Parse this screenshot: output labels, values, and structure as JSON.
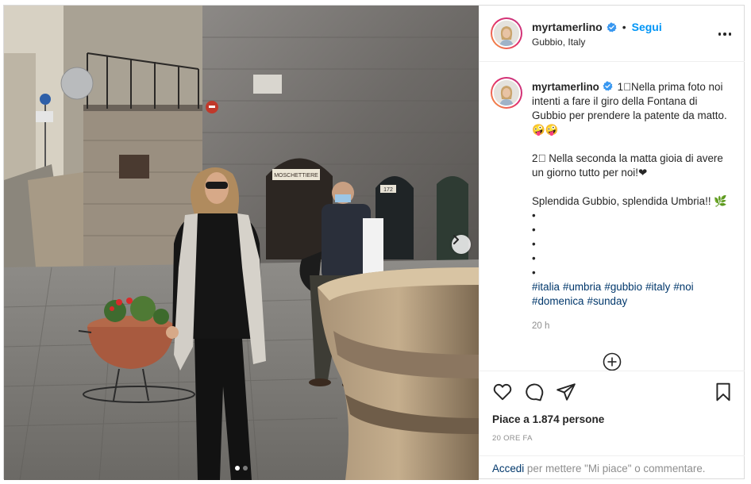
{
  "post": {
    "username": "myrtamerlino",
    "follow_label": "Segui",
    "separator": "•",
    "location": "Gubbio, Italy",
    "verified": true,
    "accent_color": "#0095f6",
    "caption_user": "myrtamerlino",
    "caption_text": " 1⃣Nella prima foto noi intenti a fare il giro della Fontana di Gubbio per prendere la patente da matto. 🤪🤪\n\n2⃣ Nella seconda la matta gioia di avere un giorno tutto per noi!❤\n\nSplendida Gubbio, splendida Umbria!! 🌿\n•\n•\n•\n•\n•",
    "hashtags": [
      "#italia",
      "#umbria",
      "#gubbio",
      "#italy",
      "#noi",
      "#domenica",
      "#sunday"
    ],
    "time_ago": "20 h",
    "likes_text": "Piace a 1.874 persone",
    "date_text": "20 ORE FA",
    "footer_login": "Accedi",
    "footer_rest": " per mettere \"Mi piace\" o commentare."
  },
  "photo": {
    "sign_text": "MOSCHETTIERE",
    "sign2_text": "172",
    "current_slide": 1,
    "slide_count": 2
  },
  "icons": [
    "heart-icon",
    "comment-icon",
    "share-icon",
    "bookmark-icon",
    "more-icon",
    "verified-icon",
    "chevron-right-icon",
    "plus-circle-icon"
  ]
}
